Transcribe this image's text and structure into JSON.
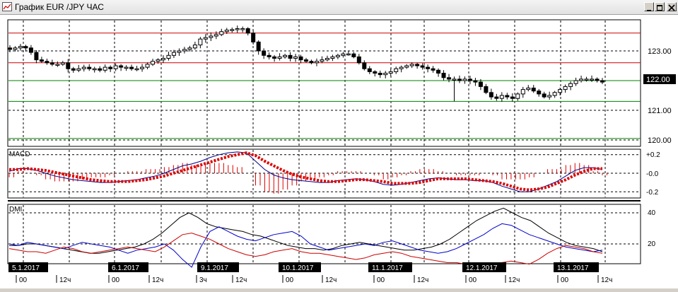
{
  "window": {
    "title": "График EUR /JPY  ЧАС"
  },
  "colors": {
    "background": "#ffffff",
    "grid": "#000000",
    "candle": "#000000",
    "resistance_line": "#cc0000",
    "support_line": "#008000",
    "macd_line": "#00008b",
    "macd_signal": "#dd0000",
    "dmi_adx": "#000000",
    "dmi_plus": "#0000cc",
    "dmi_minus": "#cc0000"
  },
  "icons": {
    "app": "chart-icon",
    "minimize": "minimize-icon",
    "maximize": "maximize-icon",
    "close": "close-icon"
  },
  "chart_data": [
    {
      "type": "candlestick",
      "title": "",
      "y_ticks": [
        "123.00",
        "121.00",
        "120.00"
      ],
      "current_price_label": "122.00",
      "ylim": [
        119.8,
        124.0
      ],
      "horizontal_lines": [
        {
          "value": 123.6,
          "kind": "resistance"
        },
        {
          "value": 122.6,
          "kind": "resistance"
        },
        {
          "value": 122.0,
          "kind": "support"
        },
        {
          "value": 121.3,
          "kind": "support"
        },
        {
          "value": 120.05,
          "kind": "support"
        }
      ],
      "close_path": [
        123.05,
        123.1,
        123.15,
        123.1,
        122.95,
        122.7,
        122.65,
        122.6,
        122.55,
        122.55,
        122.6,
        122.4,
        122.35,
        122.4,
        122.45,
        122.4,
        122.4,
        122.35,
        122.45,
        122.4,
        122.5,
        122.45,
        122.45,
        122.4,
        122.4,
        122.45,
        122.55,
        122.65,
        122.7,
        122.75,
        122.85,
        122.95,
        123.0,
        123.05,
        123.1,
        123.2,
        123.4,
        123.45,
        123.5,
        123.55,
        123.65,
        123.7,
        123.72,
        123.75,
        123.75,
        123.6,
        123.3,
        123.0,
        122.85,
        122.8,
        122.75,
        122.8,
        122.85,
        122.75,
        122.8,
        122.7,
        122.65,
        122.6,
        122.65,
        122.7,
        122.75,
        122.8,
        122.85,
        122.9,
        122.9,
        122.8,
        122.6,
        122.4,
        122.3,
        122.25,
        122.2,
        122.25,
        122.3,
        122.4,
        122.45,
        122.5,
        122.55,
        122.5,
        122.45,
        122.4,
        122.35,
        122.25,
        122.1,
        122.05,
        122.05,
        122.0,
        122.05,
        122.0,
        121.95,
        121.8,
        121.6,
        121.45,
        121.4,
        121.5,
        121.45,
        121.4,
        121.55,
        121.7,
        121.75,
        121.65,
        121.55,
        121.45,
        121.5,
        121.6,
        121.7,
        121.8,
        121.9,
        122.0,
        122.05,
        122.05,
        122.05,
        122.0,
        121.95
      ]
    },
    {
      "type": "line",
      "title": "MACD",
      "y_ticks": [
        "+0.2",
        "-0.0",
        "-0.2"
      ],
      "ylim": [
        -0.23,
        0.26
      ],
      "series": [
        {
          "role": "macd",
          "values": [
            0.02,
            0.05,
            0.05,
            0.03,
            0.0,
            -0.03,
            -0.05,
            -0.07,
            -0.08,
            -0.09,
            -0.1,
            -0.1,
            -0.09,
            -0.08,
            -0.07,
            -0.05,
            -0.03,
            0.0,
            0.04,
            0.08,
            0.1,
            0.13,
            0.17,
            0.2,
            0.22,
            0.23,
            0.22,
            0.13,
            0.04,
            -0.02,
            -0.05,
            -0.07,
            -0.08,
            -0.09,
            -0.1,
            -0.1,
            -0.08,
            -0.07,
            -0.06,
            -0.07,
            -0.09,
            -0.12,
            -0.13,
            -0.12,
            -0.1,
            -0.08,
            -0.06,
            -0.05,
            -0.06,
            -0.07,
            -0.07,
            -0.08,
            -0.08,
            -0.1,
            -0.14,
            -0.17,
            -0.2,
            -0.2,
            -0.17,
            -0.13,
            -0.09,
            -0.03,
            0.03,
            0.06,
            0.06,
            0.04
          ]
        },
        {
          "role": "signal",
          "values": [
            0.04,
            0.04,
            0.05,
            0.04,
            0.03,
            0.01,
            -0.01,
            -0.03,
            -0.05,
            -0.07,
            -0.08,
            -0.09,
            -0.09,
            -0.09,
            -0.08,
            -0.07,
            -0.05,
            -0.03,
            0.0,
            0.03,
            0.06,
            0.09,
            0.12,
            0.15,
            0.18,
            0.2,
            0.22,
            0.19,
            0.13,
            0.08,
            0.03,
            -0.01,
            -0.04,
            -0.06,
            -0.08,
            -0.09,
            -0.09,
            -0.08,
            -0.07,
            -0.07,
            -0.08,
            -0.09,
            -0.11,
            -0.11,
            -0.11,
            -0.1,
            -0.08,
            -0.06,
            -0.06,
            -0.06,
            -0.06,
            -0.07,
            -0.08,
            -0.09,
            -0.11,
            -0.14,
            -0.17,
            -0.18,
            -0.17,
            -0.15,
            -0.11,
            -0.07,
            -0.02,
            0.02,
            0.05,
            0.05
          ]
        }
      ]
    },
    {
      "type": "line",
      "title": "DMI",
      "y_ticks": [
        "40",
        "20"
      ],
      "ylim": [
        5,
        46
      ],
      "series": [
        {
          "role": "adx",
          "values": [
            19,
            19,
            20,
            20,
            19,
            18,
            17,
            16,
            15,
            14,
            14,
            15,
            16,
            17,
            18,
            20,
            23,
            27,
            32,
            37,
            40,
            37,
            33,
            31,
            30,
            29,
            28,
            26,
            25,
            23,
            21,
            19,
            18,
            17,
            17,
            16,
            17,
            19,
            20,
            21,
            20,
            19,
            18,
            17,
            16,
            16,
            17,
            18,
            20,
            23,
            27,
            31,
            35,
            38,
            41,
            43,
            40,
            37,
            35,
            31,
            27,
            24,
            21,
            19,
            18,
            17,
            15
          ]
        },
        {
          "role": "plus_di",
          "values": [
            20,
            19,
            21,
            20,
            19,
            18,
            17,
            19,
            21,
            20,
            19,
            18,
            16,
            14,
            16,
            17,
            18,
            20,
            16,
            10,
            5,
            18,
            28,
            31,
            28,
            25,
            23,
            22,
            24,
            26,
            27,
            28,
            25,
            20,
            18,
            16,
            17,
            18,
            19,
            20,
            19,
            21,
            22,
            20,
            18,
            16,
            15,
            14,
            15,
            17,
            20,
            23,
            26,
            30,
            33,
            32,
            29,
            26,
            24,
            22,
            20,
            18,
            17,
            16,
            15,
            16
          ]
        },
        {
          "role": "minus_di",
          "values": [
            17,
            16,
            15,
            15,
            14,
            16,
            18,
            17,
            15,
            14,
            15,
            16,
            17,
            18,
            17,
            16,
            15,
            18,
            22,
            26,
            27,
            25,
            23,
            20,
            17,
            15,
            13,
            12,
            13,
            15,
            16,
            17,
            15,
            14,
            14,
            13,
            12,
            11,
            10,
            11,
            13,
            14,
            15,
            14,
            12,
            11,
            10,
            9,
            8,
            8,
            7,
            7,
            6,
            7,
            8,
            9,
            8,
            7,
            10,
            14,
            17,
            19,
            18,
            17,
            15,
            14
          ]
        }
      ]
    }
  ],
  "x_axis": {
    "date_labels": [
      "5.1.2017",
      "6.1.2017",
      "9.1.2017",
      "10.1.2017",
      "11.1.2017",
      "12.1.2017",
      "13.1.2017"
    ],
    "hour_labels": [
      "00",
      "12ч",
      "00",
      "12ч",
      "3ч",
      "12ч",
      "00",
      "12ч",
      "00",
      "12ч",
      "00",
      "12ч",
      "00",
      "12ч"
    ]
  }
}
